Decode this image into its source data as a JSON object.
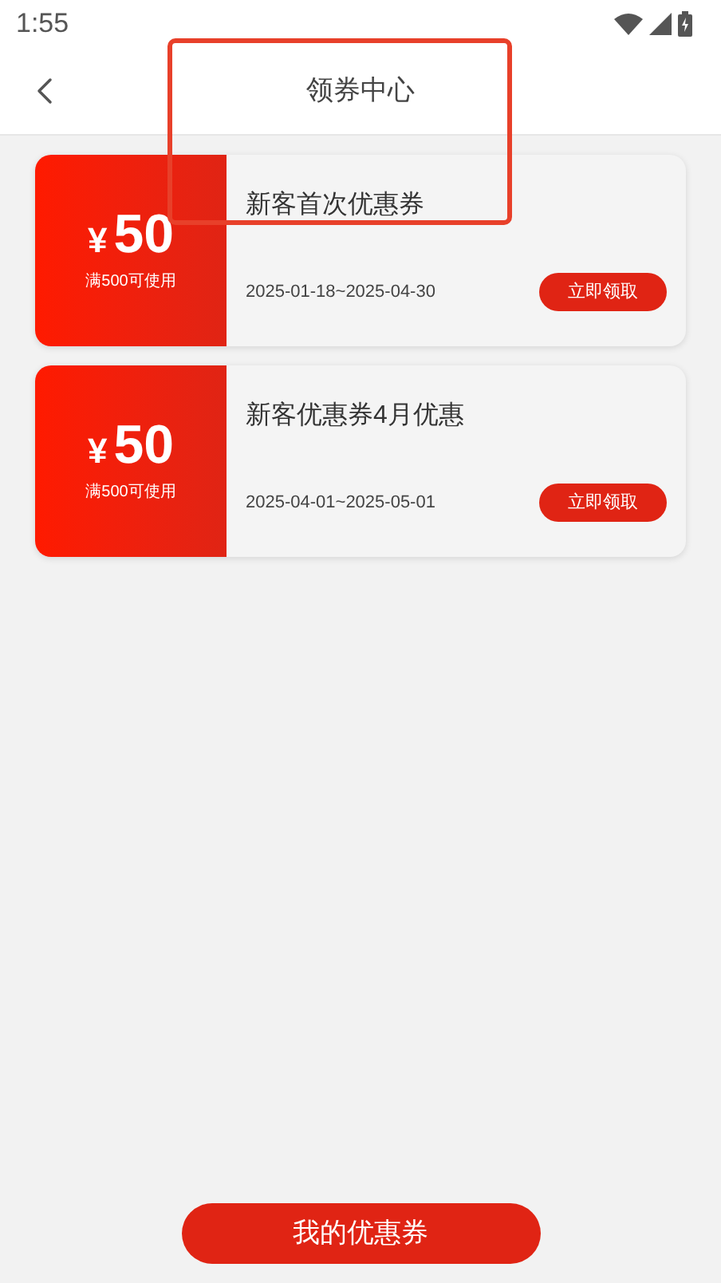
{
  "status_bar": {
    "time": "1:55"
  },
  "header": {
    "title": "领券中心"
  },
  "annotation": {
    "kind": "highlight",
    "color": "#e8402a"
  },
  "coupons": [
    {
      "currency": "¥",
      "amount": "50",
      "condition": "满500可使用",
      "title": "新客首次优惠券",
      "validity": "2025-01-18~2025-04-30",
      "button": "立即领取"
    },
    {
      "currency": "¥",
      "amount": "50",
      "condition": "满500可使用",
      "title": "新客优惠券4月优惠",
      "validity": "2025-04-01~2025-05-01",
      "button": "立即领取"
    }
  ],
  "footer_button": "我的优惠券"
}
